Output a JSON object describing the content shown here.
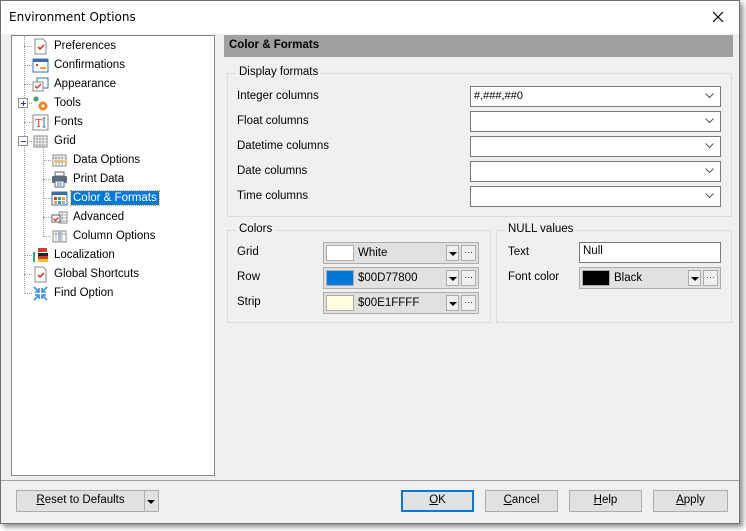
{
  "window": {
    "title": "Environment Options",
    "close_icon": "close-icon"
  },
  "tree": {
    "items": [
      {
        "label": "Preferences",
        "icon": "preferences-icon",
        "level": 0
      },
      {
        "label": "Confirmations",
        "icon": "confirmations-icon",
        "level": 0
      },
      {
        "label": "Appearance",
        "icon": "appearance-icon",
        "level": 0
      },
      {
        "label": "Tools",
        "icon": "tools-gear-icon",
        "level": 0,
        "expander": "collapsed"
      },
      {
        "label": "Fonts",
        "icon": "fonts-icon",
        "level": 0
      },
      {
        "label": "Grid",
        "icon": "grid-icon",
        "level": 0,
        "expander": "expanded"
      },
      {
        "label": "Data Options",
        "icon": "data-options-icon",
        "level": 1
      },
      {
        "label": "Print Data",
        "icon": "printer-icon",
        "level": 1
      },
      {
        "label": "Color & Formats",
        "icon": "color-formats-icon",
        "level": 1,
        "selected": true
      },
      {
        "label": "Advanced",
        "icon": "advanced-icon",
        "level": 1
      },
      {
        "label": "Column Options",
        "icon": "column-options-icon",
        "level": 1
      },
      {
        "label": "Localization",
        "icon": "localization-icon",
        "level": 0
      },
      {
        "label": "Global Shortcuts",
        "icon": "global-shortcuts-icon",
        "level": 0
      },
      {
        "label": "Find Option",
        "icon": "find-option-icon",
        "level": 0
      }
    ]
  },
  "panel": {
    "title": "Color & Formats",
    "display_formats": {
      "legend": "Display formats",
      "fields": [
        {
          "label": "Integer columns",
          "value": "#,###,##0"
        },
        {
          "label": "Float columns",
          "value": ""
        },
        {
          "label": "Datetime columns",
          "value": ""
        },
        {
          "label": "Date columns",
          "value": ""
        },
        {
          "label": "Time columns",
          "value": ""
        }
      ]
    },
    "colors": {
      "legend": "Colors",
      "fields": [
        {
          "label": "Grid",
          "value": "White",
          "swatch": "#ffffff"
        },
        {
          "label": "Row",
          "value": "$00D77800",
          "swatch": "#0078d7"
        },
        {
          "label": "Strip",
          "value": "$00E1FFFF",
          "swatch": "#ffffe1"
        }
      ],
      "ellipsis": "···"
    },
    "null_values": {
      "legend": "NULL values",
      "text_label": "Text",
      "text_value": "Null",
      "font_color_label": "Font color",
      "font_color_value": "Black",
      "font_color_swatch": "#000000",
      "ellipsis": "···"
    }
  },
  "footer": {
    "reset_prefix": "",
    "reset_mnemonic": "R",
    "reset_rest": "eset to Defaults",
    "ok_mnemonic": "O",
    "ok_rest": "K",
    "cancel_mnemonic": "C",
    "cancel_rest": "ancel",
    "help_mnemonic": "H",
    "help_rest": "elp",
    "apply_mnemonic": "A",
    "apply_rest": "pply"
  }
}
